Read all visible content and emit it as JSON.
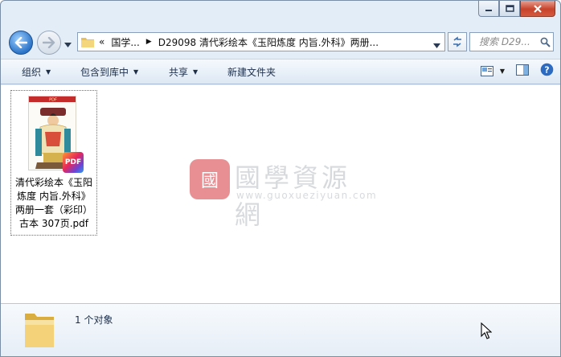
{
  "window": {
    "caption": {
      "minimize": "minimize",
      "maximize": "maximize",
      "close": "close"
    }
  },
  "nav": {
    "breadcrumb": [
      "国学...",
      "D29098 清代彩绘本《玉阳炼度 内旨.外科》两册..."
    ],
    "overflow_marker": "«",
    "search_placeholder": "搜索 D29...",
    "icons": [
      "back-arrow-icon",
      "forward-arrow-icon",
      "dropdown-icon",
      "folder-icon",
      "refresh-icon",
      "search-icon"
    ]
  },
  "commands": {
    "organize": "组织",
    "include_in_library": "包含到库中",
    "share": "共享",
    "new_folder": "新建文件夹",
    "icons": [
      "view-options-icon",
      "preview-pane-icon",
      "help-icon"
    ]
  },
  "files": [
    {
      "name": "清代彩绘本《玉阳炼度 内旨.外科》两册一套（彩印）古本 307页.pdf",
      "label_lines": [
        "清代彩绘本《玉阳",
        "炼度 内旨.外科》",
        "两册一套（彩印）",
        "古本 307页.pdf"
      ],
      "badge": "PDF",
      "thumb_header": "PDF"
    }
  ],
  "watermark": {
    "seal": "國",
    "title": "國學資源網",
    "url": "www.guoxueziyuan.com"
  },
  "status": {
    "item_count": "1 个对象"
  },
  "colors": {
    "accent": "#2b74c7",
    "close_red": "#c7432b",
    "pdf_badge": "#e5285b"
  }
}
